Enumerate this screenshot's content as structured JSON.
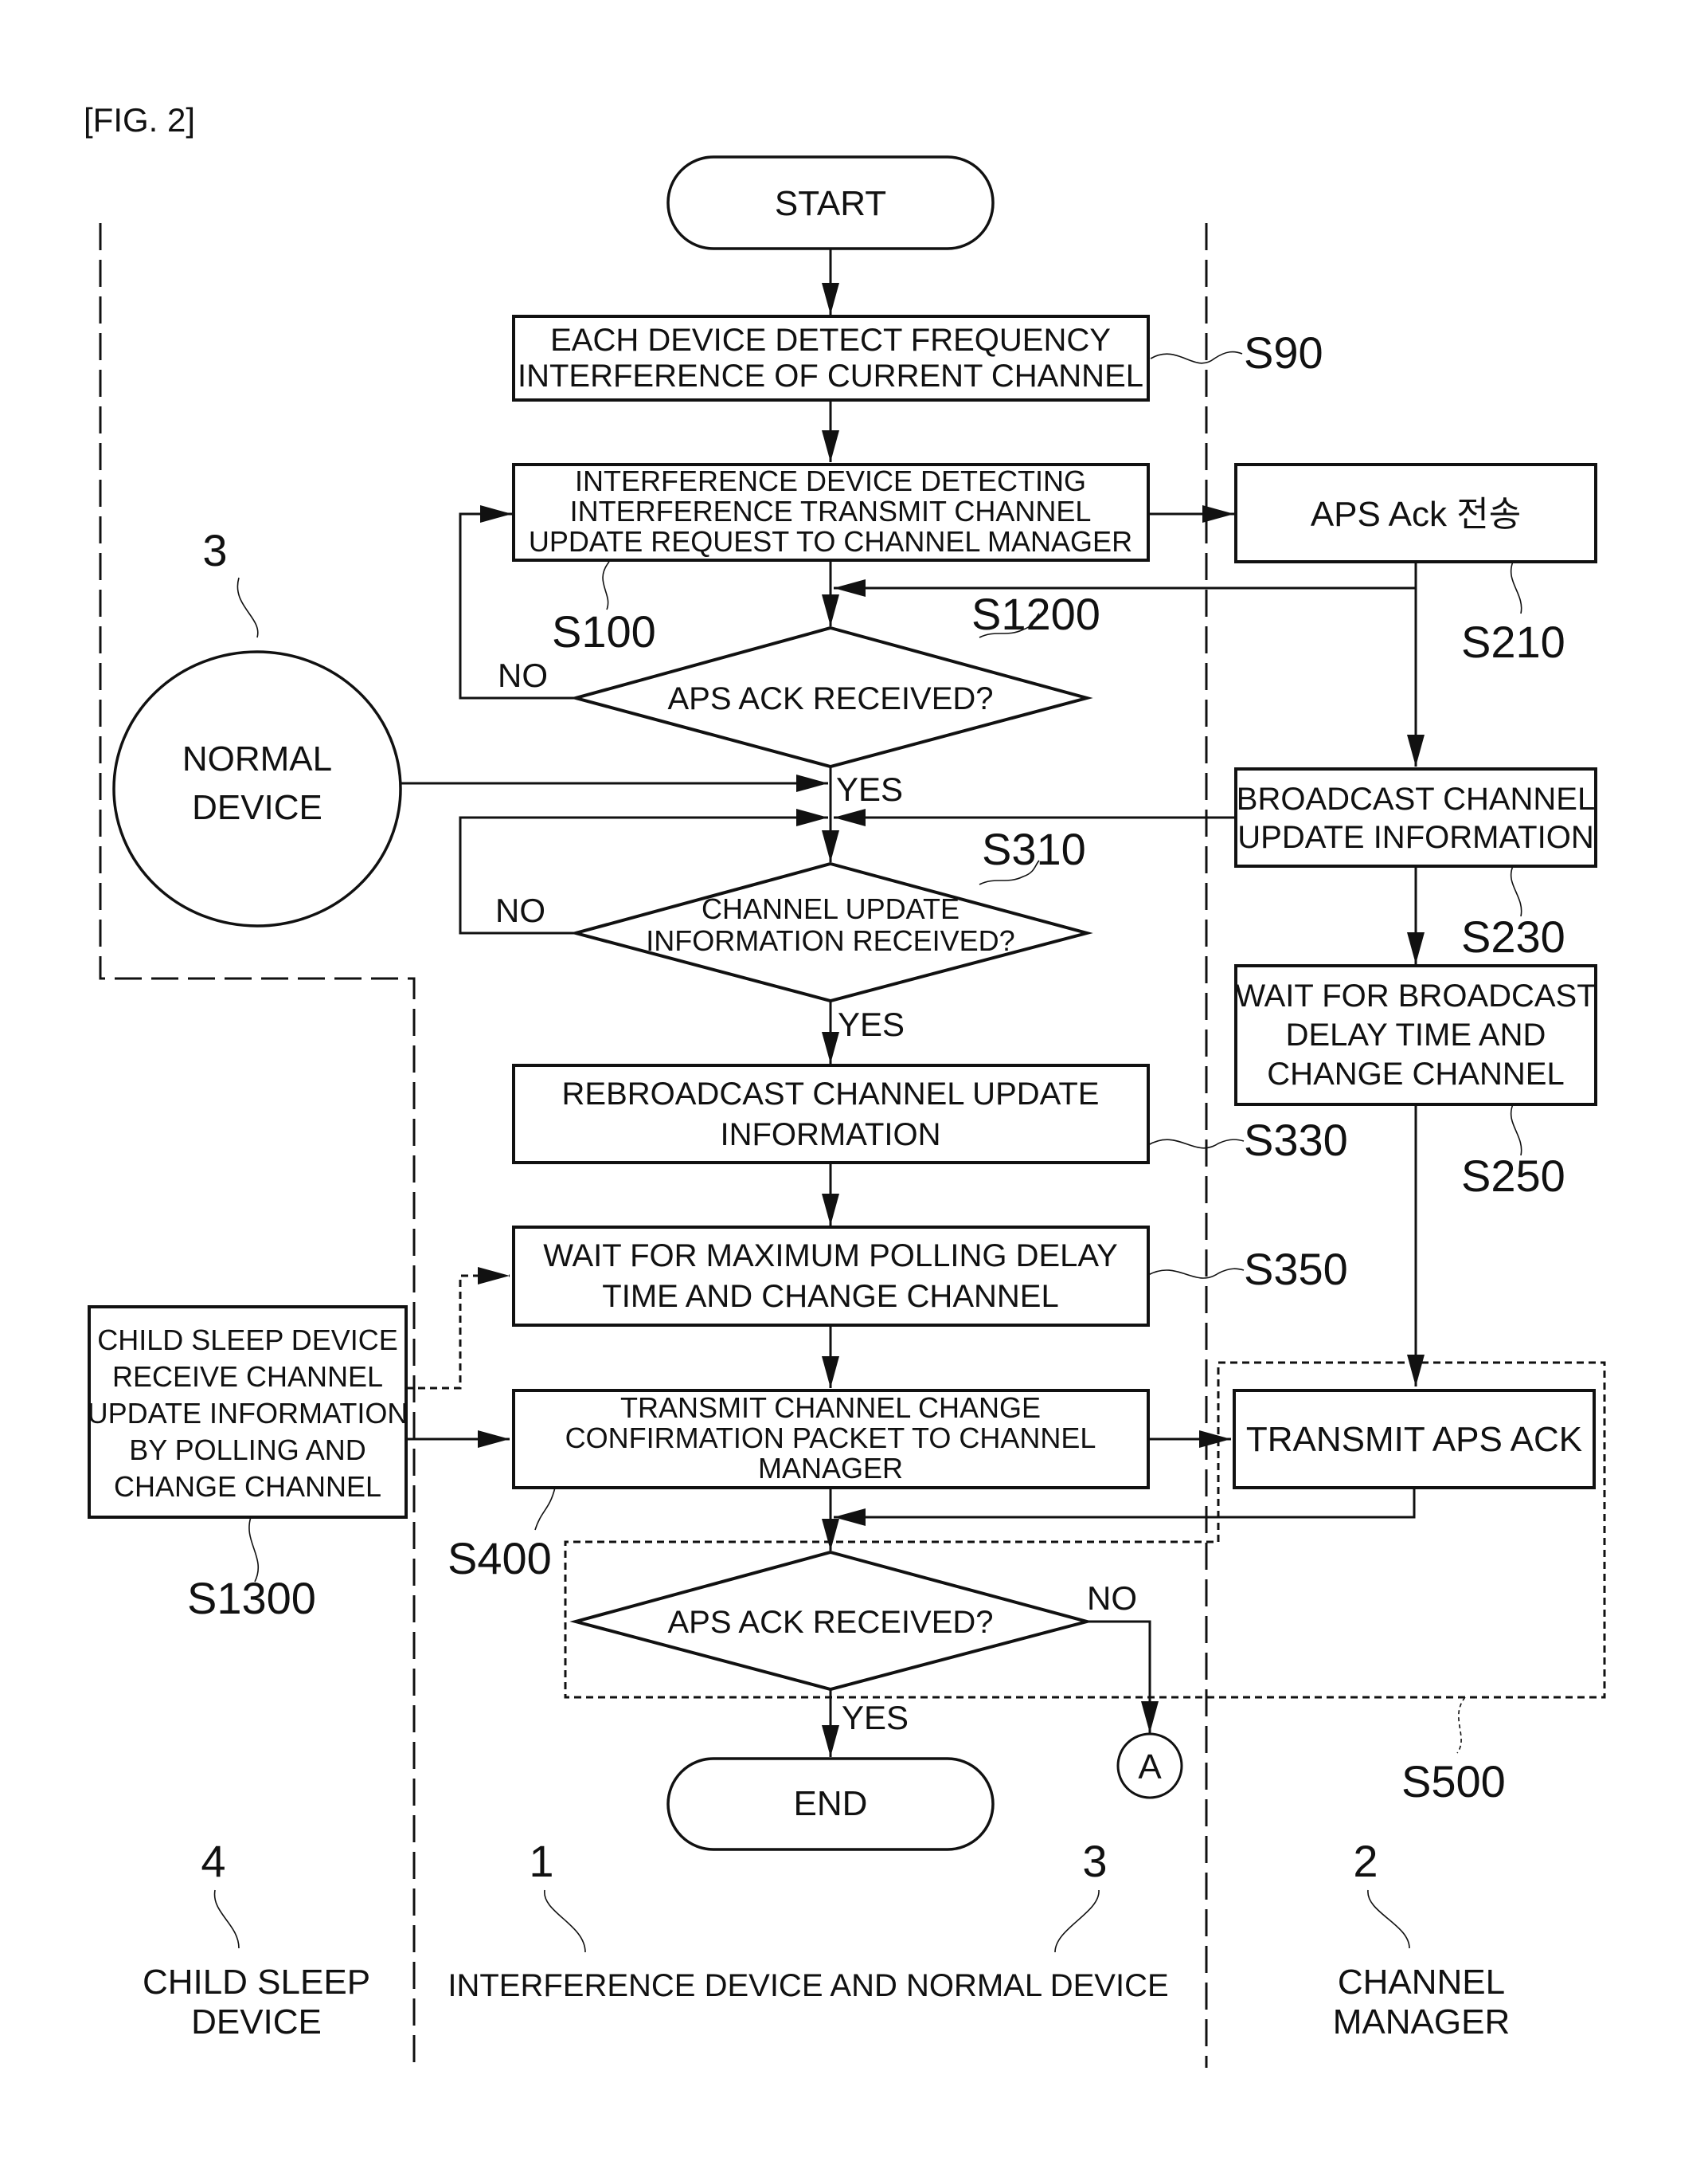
{
  "figure": {
    "title": "[FIG. 2]"
  },
  "flow": {
    "start": "START",
    "end": "END",
    "connector_a": "A",
    "s90": {
      "id": "S90",
      "lines": [
        "EACH DEVICE DETECT FREQUENCY",
        "INTERFERENCE OF CURRENT CHANNEL"
      ]
    },
    "s100": {
      "id": "S100",
      "lines": [
        "INTERFERENCE DEVICE DETECTING",
        "INTERFERENCE TRANSMIT CHANNEL",
        "UPDATE REQUEST TO CHANNEL MANAGER"
      ]
    },
    "s210": {
      "id": "S210",
      "text": "APS Ack 전송"
    },
    "s1200": {
      "id": "S1200",
      "text": "APS ACK RECEIVED?",
      "no": "NO",
      "yes": "YES"
    },
    "s230": {
      "id": "S230",
      "lines": [
        "BROADCAST CHANNEL",
        "UPDATE INFORMATION"
      ]
    },
    "s310": {
      "id": "S310",
      "lines": [
        "CHANNEL UPDATE",
        "INFORMATION RECEIVED?"
      ],
      "no": "NO",
      "yes": "YES"
    },
    "s250": {
      "id": "S250",
      "lines": [
        "WAIT FOR BROADCAST",
        "DELAY TIME AND",
        "CHANGE CHANNEL"
      ]
    },
    "s330": {
      "id": "S330",
      "lines": [
        "REBROADCAST CHANNEL UPDATE",
        "INFORMATION"
      ]
    },
    "s350": {
      "id": "S350",
      "lines": [
        "WAIT FOR MAXIMUM POLLING DELAY",
        "TIME AND CHANGE CHANNEL"
      ]
    },
    "s1300": {
      "id": "S1300",
      "lines": [
        "CHILD SLEEP DEVICE",
        "RECEIVE CHANNEL",
        "UPDATE INFORMATION",
        "BY POLLING AND",
        "CHANGE CHANNEL"
      ]
    },
    "s400": {
      "id": "S400",
      "lines": [
        "TRANSMIT CHANNEL CHANGE",
        "CONFIRMATION PACKET TO CHANNEL",
        "MANAGER"
      ]
    },
    "s500": {
      "id": "S500",
      "transmit": "TRANSMIT APS ACK",
      "decision": "APS ACK RECEIVED?",
      "no": "NO",
      "yes": "YES"
    },
    "normal_device": {
      "ref": "3",
      "lines": [
        "NORMAL",
        "DEVICE"
      ]
    }
  },
  "lanes": [
    {
      "ref": "4",
      "lines": [
        "CHILD SLEEP",
        "DEVICE"
      ]
    },
    {
      "ref": "1",
      "lines": [
        "INTERFERENCE DEVICE AND NORMAL DEVICE"
      ]
    },
    {
      "ref": "3",
      "lines": []
    },
    {
      "ref": "2",
      "lines": [
        "CHANNEL",
        "MANAGER"
      ]
    }
  ]
}
